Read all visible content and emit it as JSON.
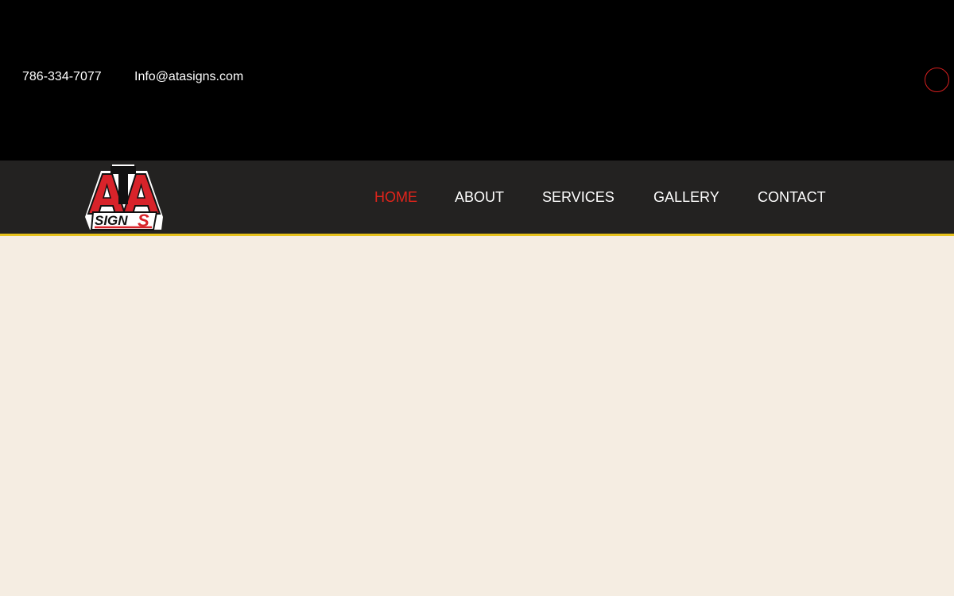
{
  "topbar": {
    "phone": "786-334-7077",
    "email": "Info@atasigns.com"
  },
  "logo": {
    "text_top": "ATA",
    "text_bottom": "SIGNS",
    "colors": {
      "red": "#d8232a",
      "black": "#111111",
      "white": "#ffffff"
    }
  },
  "nav": {
    "items": [
      {
        "label": "HOME",
        "active": true
      },
      {
        "label": "ABOUT",
        "active": false
      },
      {
        "label": "SERVICES",
        "active": false
      },
      {
        "label": "GALLERY",
        "active": false
      },
      {
        "label": "CONTACT",
        "active": false
      }
    ]
  },
  "colors": {
    "topbar_bg": "#000000",
    "navbar_bg": "#232221",
    "accent_red": "#e2241b",
    "stripe_yellow": "#e7c21c",
    "page_bg": "#f5ede2"
  }
}
